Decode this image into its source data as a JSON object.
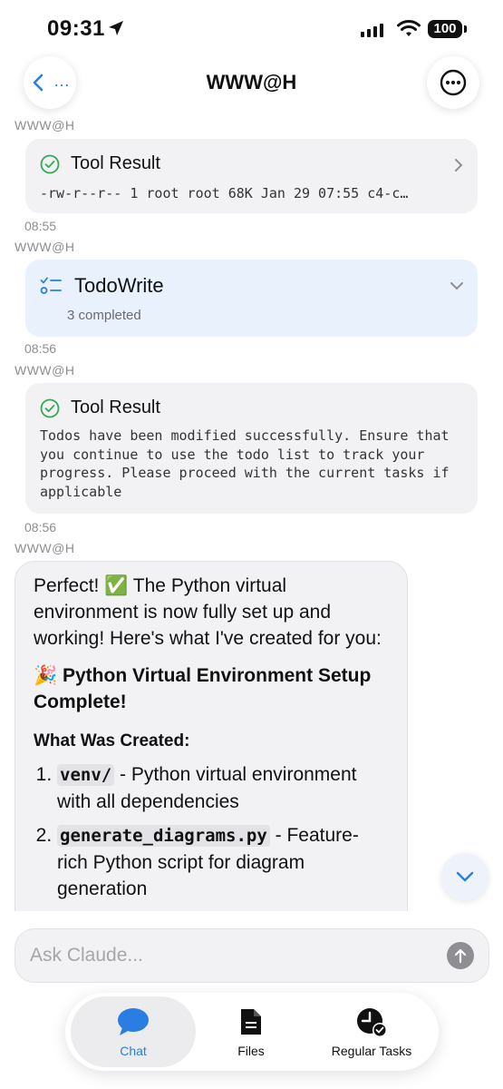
{
  "status_bar": {
    "time": "09:31",
    "battery": "100"
  },
  "header": {
    "back_label": "…",
    "title": "WWW@H"
  },
  "messages": [
    {
      "sender": "WWW@H",
      "type": "tool_result",
      "title": "Tool Result",
      "body": "-rw-r--r-- 1 root root  68K Jan 29 07:55 c4-c…",
      "collapsed": true
    },
    {
      "time": "08:55",
      "sender": "WWW@H",
      "type": "todo",
      "title": "TodoWrite",
      "subtitle": "3 completed"
    },
    {
      "time": "08:56",
      "sender": "WWW@H",
      "type": "tool_result",
      "title": "Tool Result",
      "body": "Todos have been modified successfully. Ensure that you continue to use the todo list to track your progress. Please proceed with the current tasks if applicable"
    },
    {
      "time": "08:56",
      "sender": "WWW@H",
      "type": "assistant",
      "intro": "Perfect! ✅ The Python virtual environment is now fully set up and working! Here's what I've created for you:",
      "heading": "🎉 Python Virtual Environment Setup Complete!",
      "subheading": "What Was Created:",
      "items": [
        {
          "code": "venv/",
          "text": " - Python virtual environment with all dependencies"
        },
        {
          "code": "generate_diagrams.py",
          "text": " - Feature-rich Python script for diagram generation"
        }
      ]
    }
  ],
  "input": {
    "placeholder": "Ask Claude..."
  },
  "tabs": [
    {
      "label": "Chat",
      "active": true
    },
    {
      "label": "Files"
    },
    {
      "label": "Regular Tasks"
    }
  ],
  "colors": {
    "accent": "#2a7de1",
    "check": "#34a853",
    "card": "#f2f2f4",
    "todo_card": "#e8f1fc"
  }
}
